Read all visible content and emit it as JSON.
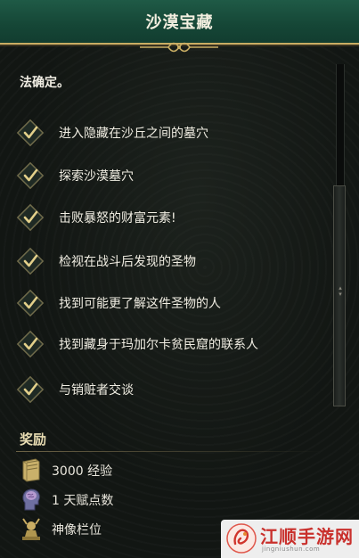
{
  "header": {
    "title": "沙漠宝藏"
  },
  "quest": {
    "intro": "法确定。",
    "objectives": [
      {
        "label": "进入隐藏在沙丘之间的墓穴",
        "completed": true
      },
      {
        "label": "探索沙漠墓穴",
        "completed": true
      },
      {
        "label": "击败暴怒的财富元素!",
        "completed": true
      },
      {
        "label": "检视在战斗后发现的圣物",
        "completed": true
      },
      {
        "label": "找到可能更了解这件圣物的人",
        "completed": true
      },
      {
        "label": "找到藏身于玛加尔卡贫民窟的联系人",
        "completed": true
      },
      {
        "label": "与销赃者交谈",
        "completed": true
      }
    ]
  },
  "rewards": {
    "title": "奖励",
    "items": [
      {
        "icon": "xp-book-icon",
        "label": "3000 经验"
      },
      {
        "icon": "brain-head-icon",
        "label": "1 天赋点数"
      },
      {
        "icon": "idol-statue-icon",
        "label": "神像栏位"
      }
    ]
  },
  "watermark": {
    "text": "江顺手游网",
    "url": "jingniushun.com"
  },
  "colors": {
    "header": "#1f5a46",
    "gold": "#c9ad63",
    "check": "#e3d08a",
    "watermark_red": "#c9302c"
  }
}
